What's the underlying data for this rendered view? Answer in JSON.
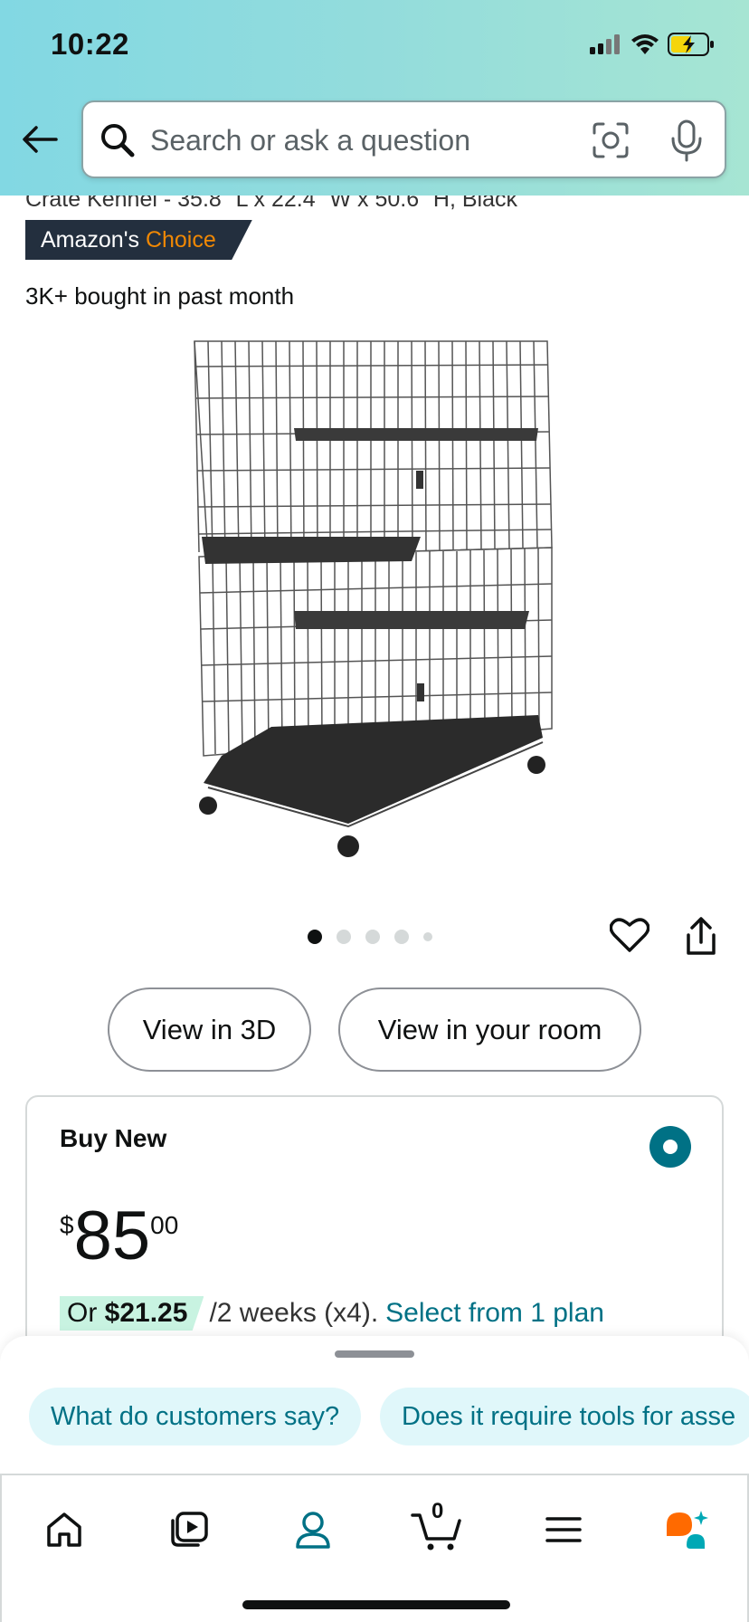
{
  "status_bar": {
    "time": "10:22"
  },
  "search": {
    "placeholder": "Search or ask a question"
  },
  "product": {
    "title_fragment": "Crate Kennel - 35.8\" L x 22.4\" W x 50.6\" H, Black",
    "badge": {
      "prefix": "Amazon's",
      "highlight": "Choice"
    },
    "bought": "3K+ bought in past month",
    "image_count": 5,
    "active_image_index": 0
  },
  "actions": {
    "view_3d": "View in 3D",
    "view_room": "View in your room"
  },
  "buy_box": {
    "title": "Buy New",
    "price": {
      "currency": "$",
      "whole": "85",
      "fraction": "00"
    },
    "installment": {
      "prefix": "Or",
      "amount": "$21.25",
      "terms": "/2 weeks (x4).",
      "link": "Select from 1 plan"
    }
  },
  "rufus_chips": [
    "What do customers say?",
    "Does it require tools for asse"
  ],
  "tabbar": {
    "cart_count": "0"
  },
  "colors": {
    "teal_link": "#007185",
    "badge_bg": "#232f3e",
    "badge_orange": "#f08804",
    "chip_bg": "#e0f7fa"
  }
}
